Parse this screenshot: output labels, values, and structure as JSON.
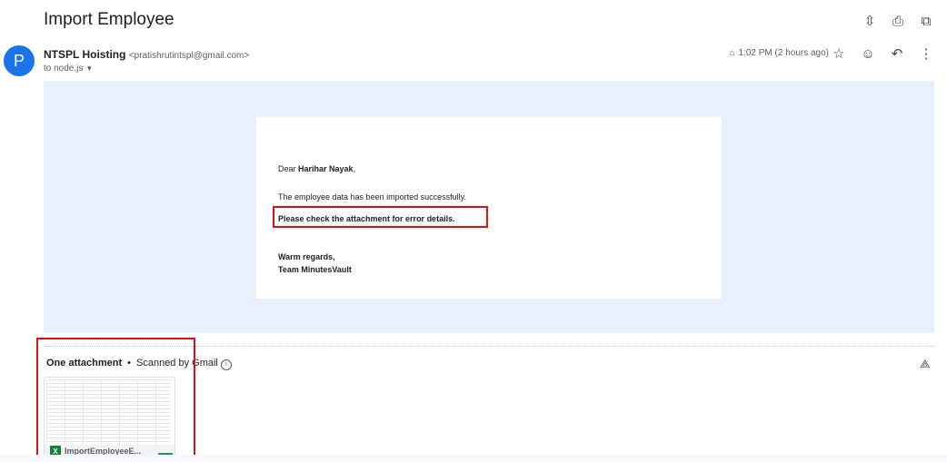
{
  "subject": "Import Employee",
  "sender": {
    "avatar_letter": "P",
    "name": "NTSPL Hoisting",
    "email": "<pratishrutintspl@gmail.com>",
    "to": "to node.js"
  },
  "meta": {
    "time": "1:02 PM (2 hours ago)"
  },
  "email_body": {
    "greeting_prefix": "Dear ",
    "recipient_name": "Harihar Nayak",
    "greeting_suffix": ",",
    "line1": "The employee data has been imported successfully.",
    "line2": "Please check the attachment for error details.",
    "closing": "Warm regards,",
    "signature": "Team MinutesVault"
  },
  "attachments": {
    "header": "One attachment",
    "scanned": "Scanned by Gmail",
    "file_name": "ImportEmployeeE..."
  },
  "icons": {
    "expand": "unfold-icon",
    "print": "print-icon",
    "open": "open-new-window-icon",
    "attachment": "paperclip-icon",
    "star": "star-icon",
    "emoji": "emoji-icon",
    "reply": "reply-icon",
    "more": "more-vert-icon",
    "drive": "add-to-drive-icon"
  },
  "colors": {
    "accent": "#1a73e8",
    "highlight_border": "#e01010",
    "body_bg": "#e8f0fe"
  }
}
